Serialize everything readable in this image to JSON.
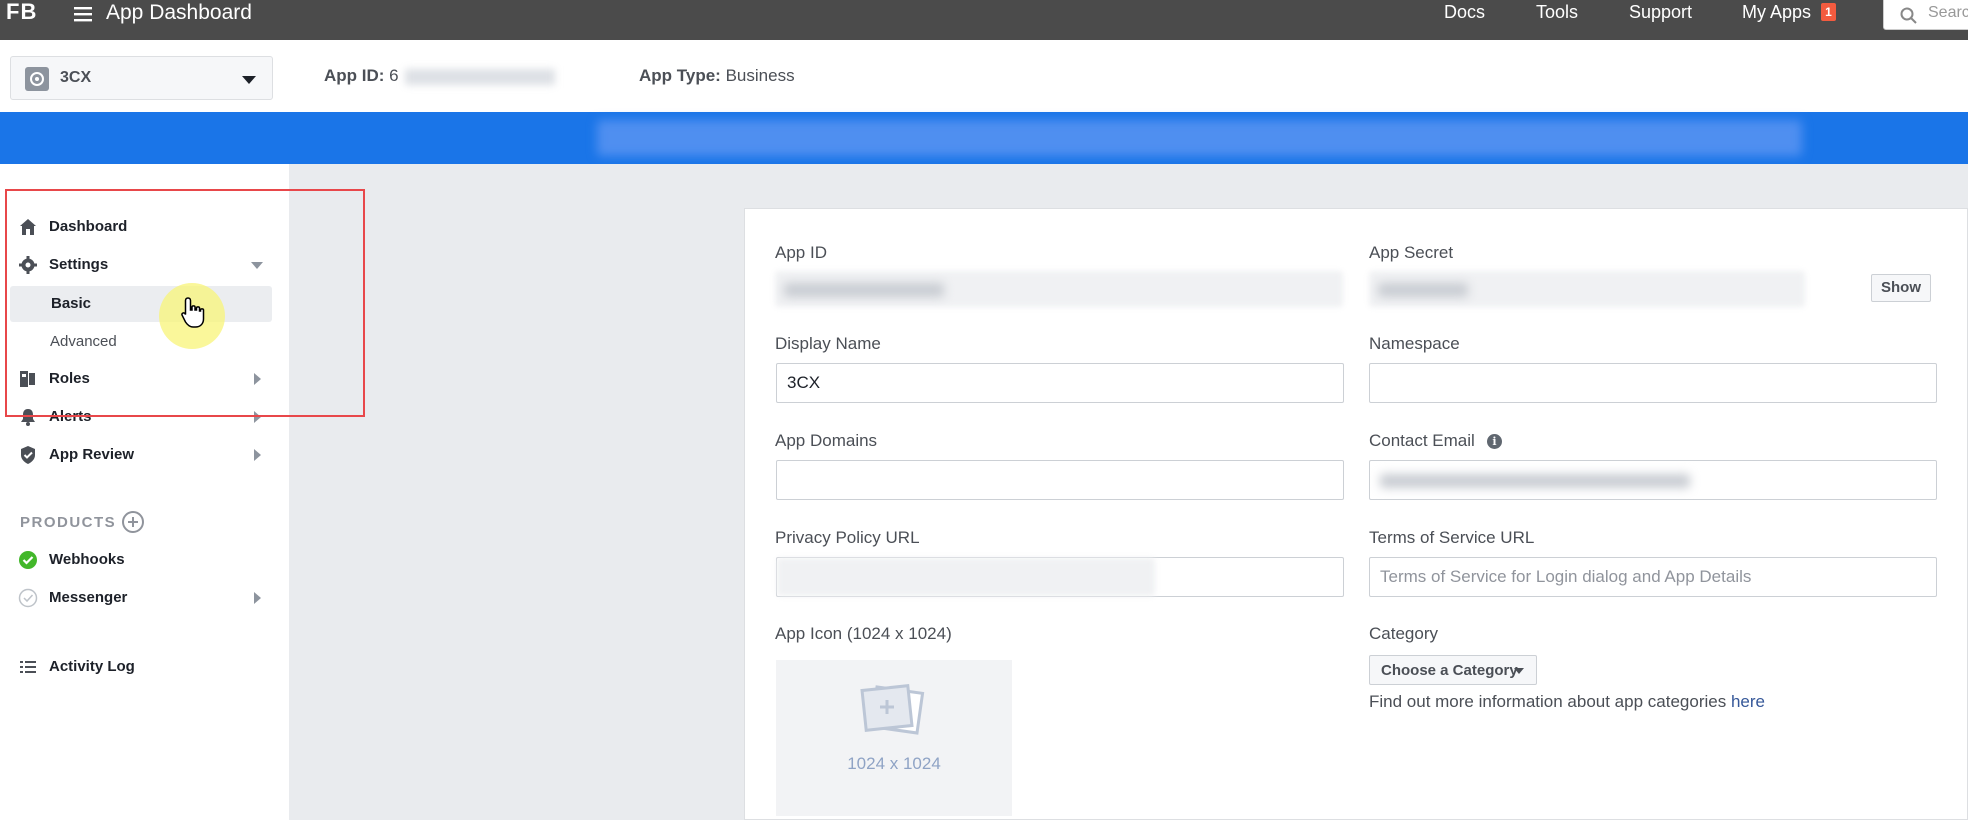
{
  "topbar": {
    "logo": "FB",
    "title": "App Dashboard",
    "nav": [
      "Docs",
      "Tools",
      "Support",
      "My Apps"
    ],
    "my_apps_badge": "1",
    "search_placeholder": "Search"
  },
  "app_header": {
    "app_name": "3CX",
    "app_id_label": "App ID:",
    "app_id_visible": "6",
    "app_type_label": "App Type:",
    "app_type_value": "Business"
  },
  "sidebar": {
    "dashboard": "Dashboard",
    "settings": "Settings",
    "basic": "Basic",
    "advanced": "Advanced",
    "roles": "Roles",
    "alerts": "Alerts",
    "app_review": "App Review",
    "products_title": "PRODUCTS",
    "webhooks": "Webhooks",
    "messenger": "Messenger",
    "activity_log": "Activity Log"
  },
  "form": {
    "app_id_label": "App ID",
    "app_secret_label": "App Secret",
    "show_button": "Show",
    "display_name_label": "Display Name",
    "display_name_value": "3CX",
    "namespace_label": "Namespace",
    "namespace_value": "",
    "app_domains_label": "App Domains",
    "app_domains_value": "",
    "contact_email_label": "Contact Email",
    "privacy_label": "Privacy Policy URL",
    "tos_label": "Terms of Service URL",
    "tos_placeholder": "Terms of Service for Login dialog and App Details",
    "app_icon_label": "App Icon (1024 x 1024)",
    "icon_size": "1024 x 1024",
    "category_label": "Category",
    "category_button": "Choose a Category",
    "category_info": "Find out more information about app categories",
    "category_link": "here"
  },
  "colors": {
    "topbar": "#4b4b4b",
    "banner": "#1a75e8",
    "highlight_frame": "#e8474a",
    "badge": "#f35b3f",
    "link": "#365899",
    "success": "#42b72a"
  }
}
